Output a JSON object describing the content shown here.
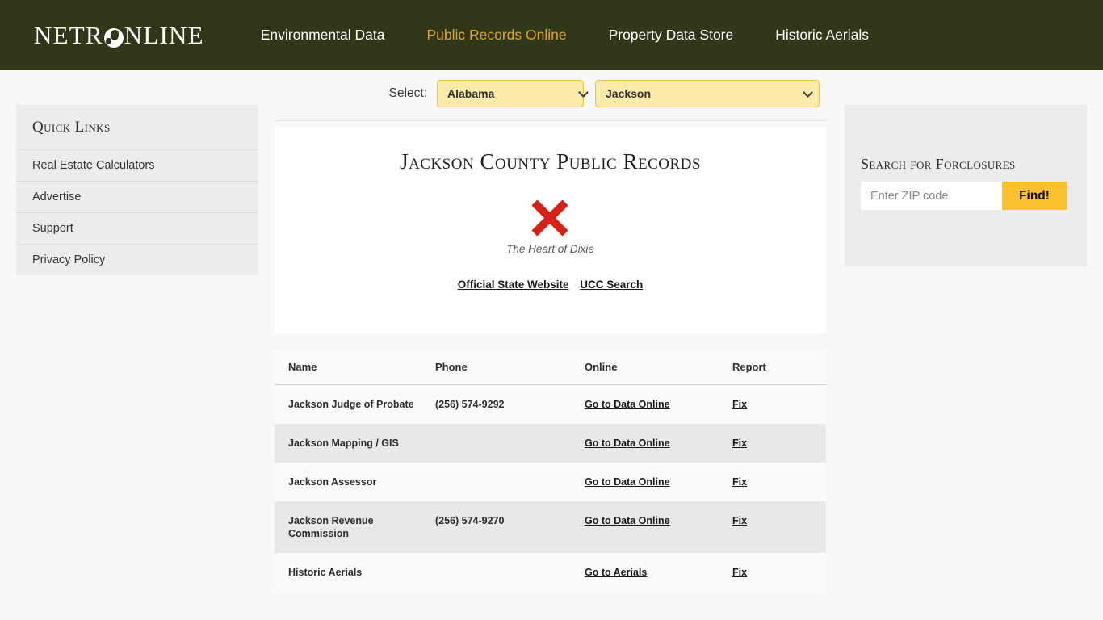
{
  "header": {
    "logo": {
      "part_a": "NETR",
      "icon": "globe-icon",
      "part_b": "NLINE"
    },
    "nav": [
      {
        "label": "Environmental Data",
        "active": false
      },
      {
        "label": "Public Records Online",
        "active": true
      },
      {
        "label": "Property Data Store",
        "active": false
      },
      {
        "label": "Historic Aerials",
        "active": false
      }
    ],
    "brand_color": "#313719",
    "active_color": "#dca422"
  },
  "sidebar": {
    "title": "Quick Links",
    "items": [
      {
        "label": "Real Estate Calculators"
      },
      {
        "label": "Advertise"
      },
      {
        "label": "Support"
      },
      {
        "label": "Privacy Policy"
      }
    ]
  },
  "selector": {
    "label": "Select:",
    "state": {
      "value": "Alabama",
      "icon": "chevron-down-icon"
    },
    "county": {
      "value": "Jackson",
      "icon": "chevron-down-icon"
    }
  },
  "record_card": {
    "title": "Jackson County Public Records",
    "seal_image": {
      "icon": "broken-image-x-icon",
      "alt": "The Heart of Dixie"
    },
    "links": [
      {
        "label": "Official State Website"
      },
      {
        "label": "UCC Search"
      }
    ]
  },
  "table": {
    "columns": [
      "Name",
      "Phone",
      "Online",
      "Report"
    ],
    "rows": [
      {
        "name": "Jackson Judge of Probate",
        "phone": "(256) 574-9292",
        "online": "Go to Data Online",
        "report": "Fix"
      },
      {
        "name": "Jackson Mapping / GIS",
        "phone": "",
        "online": "Go to Data Online",
        "report": "Fix"
      },
      {
        "name": "Jackson Assessor",
        "phone": "",
        "online": "Go to Data Online",
        "report": "Fix"
      },
      {
        "name": "Jackson Revenue Commission",
        "phone": "(256) 574-9270",
        "online": "Go to Data Online",
        "report": "Fix"
      },
      {
        "name": "Historic Aerials",
        "phone": "",
        "online": "Go to Aerials",
        "report": "Fix"
      }
    ]
  },
  "foreclosure": {
    "title": "Search for Forclosures",
    "zip_placeholder": "Enter ZIP code",
    "zip_value": "",
    "button_label": "Find!",
    "button_color": "#fbc02d"
  }
}
